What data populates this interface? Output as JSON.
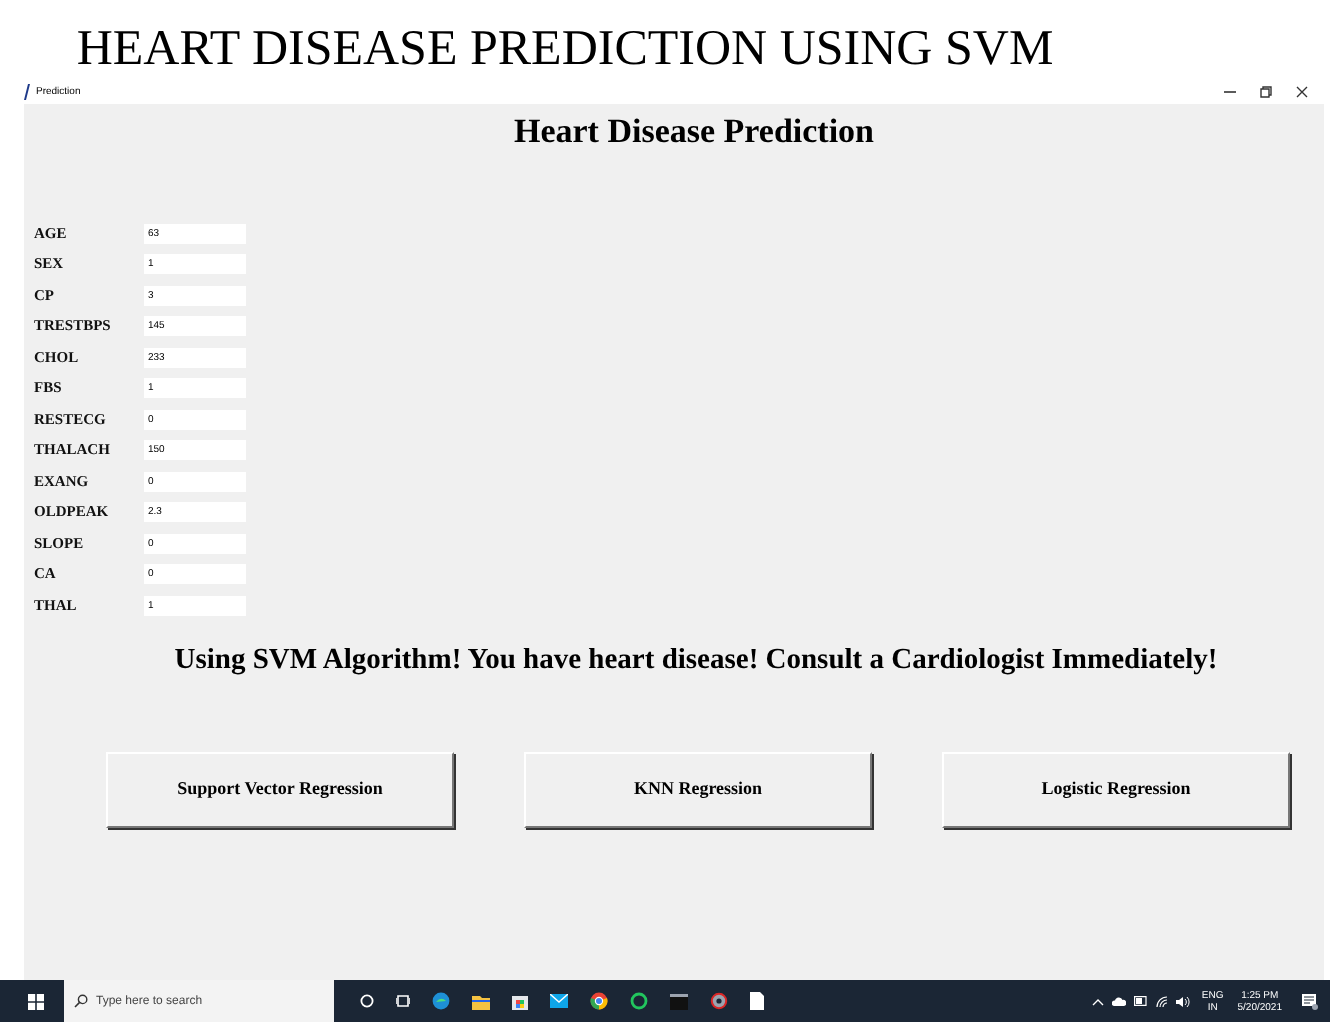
{
  "page_title": "HEART DISEASE PREDICTION USING SVM",
  "window": {
    "title": "Prediction"
  },
  "heading": "Heart Disease Prediction",
  "fields": [
    {
      "label": "AGE",
      "value": "63"
    },
    {
      "label": "SEX",
      "value": "1"
    },
    {
      "label": "CP",
      "value": "3"
    },
    {
      "label": "TRESTBPS",
      "value": "145"
    },
    {
      "label": "CHOL",
      "value": "233"
    },
    {
      "label": "FBS",
      "value": "1"
    },
    {
      "label": "RESTECG",
      "value": "0"
    },
    {
      "label": "THALACH",
      "value": "150"
    },
    {
      "label": "EXANG",
      "value": "0"
    },
    {
      "label": "OLDPEAK",
      "value": "2.3"
    },
    {
      "label": "SLOPE",
      "value": "0"
    },
    {
      "label": "CA",
      "value": "0"
    },
    {
      "label": "THAL",
      "value": "1"
    }
  ],
  "result": "Using SVM Algorithm! You have heart disease! Consult a Cardiologist Immediately!",
  "buttons": [
    "Support Vector Regression",
    "KNN Regression",
    "Logistic Regression"
  ],
  "taskbar": {
    "search_placeholder": "Type here to search",
    "language": "ENG",
    "region": "IN",
    "time": "1:25 PM",
    "date": "5/20/2021"
  }
}
